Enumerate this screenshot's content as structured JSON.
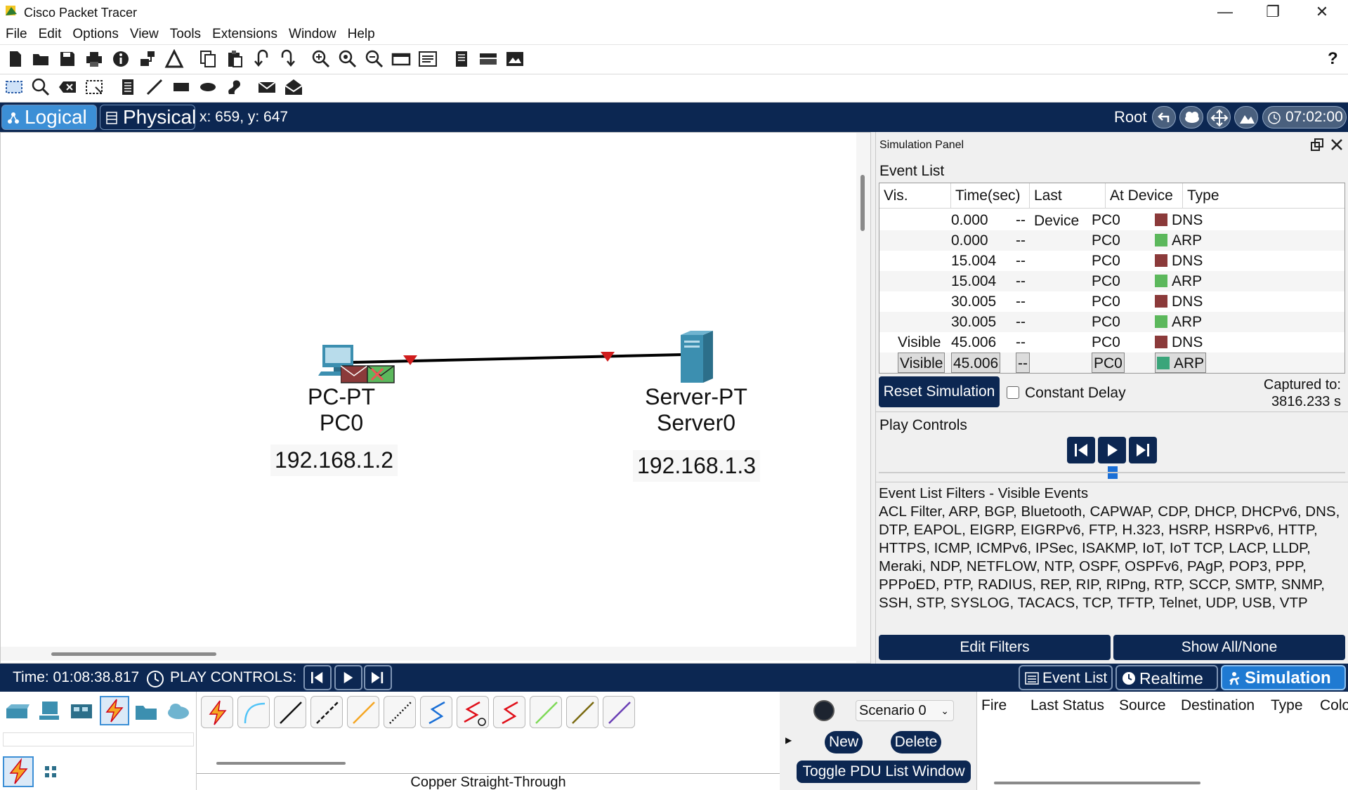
{
  "window": {
    "title": "Cisco Packet Tracer",
    "controls": [
      "minimize-icon",
      "restore-icon",
      "close-icon"
    ]
  },
  "menu": [
    "File",
    "Edit",
    "Options",
    "View",
    "Tools",
    "Extensions",
    "Window",
    "Help"
  ],
  "toolbar_main": {
    "icons": [
      "new-file-icon",
      "open-folder-icon",
      "save-icon",
      "print-icon",
      "info-icon",
      "network-wizard-icon",
      "activity-wizard-icon",
      "copy-icon",
      "paste-icon",
      "undo-icon",
      "redo-icon",
      "zoom-in-icon",
      "zoom-reset-icon",
      "zoom-out-icon",
      "drawing-palette-icon",
      "custom-device-dialog-icon",
      "document-icon",
      "device-template-icon",
      "image-view-icon"
    ],
    "help_label": "?"
  },
  "toolbar_common": {
    "icons": [
      "select-icon",
      "inspect-icon",
      "delete-icon",
      "resize-shape-icon",
      "note-icon",
      "draw-line-icon",
      "draw-rectangle-icon",
      "draw-ellipse-icon",
      "freeform-icon",
      "add-simple-pdu-icon",
      "add-complex-pdu-icon"
    ]
  },
  "modebar": {
    "logical_label": "Logical",
    "physical_label": "Physical",
    "coords": "x: 659, y: 647",
    "root_label": "Root",
    "clock": "07:02:00"
  },
  "workspace": {
    "devices": [
      {
        "type": "PC-PT",
        "name": "PC0",
        "ip": "192.168.1.2"
      },
      {
        "type": "Server-PT",
        "name": "Server0",
        "ip": "192.168.1.3"
      }
    ]
  },
  "simulation_panel": {
    "title": "Simulation Panel",
    "event_list_label": "Event List",
    "columns": [
      "Vis.",
      "Time(sec)",
      "Last Device",
      "At Device",
      "Type"
    ],
    "events": [
      {
        "vis": "",
        "time": "0.000",
        "last": "--",
        "at": "PC0",
        "type": "DNS",
        "color": "#8b3a3a",
        "selected": false
      },
      {
        "vis": "",
        "time": "0.000",
        "last": "--",
        "at": "PC0",
        "type": "ARP",
        "color": "#5cb85c",
        "selected": false
      },
      {
        "vis": "",
        "time": "15.004",
        "last": "--",
        "at": "PC0",
        "type": "DNS",
        "color": "#8b3a3a",
        "selected": false
      },
      {
        "vis": "",
        "time": "15.004",
        "last": "--",
        "at": "PC0",
        "type": "ARP",
        "color": "#5cb85c",
        "selected": false
      },
      {
        "vis": "",
        "time": "30.005",
        "last": "--",
        "at": "PC0",
        "type": "DNS",
        "color": "#8b3a3a",
        "selected": false
      },
      {
        "vis": "",
        "time": "30.005",
        "last": "--",
        "at": "PC0",
        "type": "ARP",
        "color": "#5cb85c",
        "selected": false
      },
      {
        "vis": "Visible",
        "time": "45.006",
        "last": "--",
        "at": "PC0",
        "type": "DNS",
        "color": "#8b3a3a",
        "selected": false
      },
      {
        "vis": "Visible",
        "time": "45.006",
        "last": "--",
        "at": "PC0",
        "type": "ARP",
        "color": "#3aa57a",
        "selected": true
      }
    ],
    "reset_label": "Reset Simulation",
    "constant_delay_label": "Constant Delay",
    "constant_delay_checked": false,
    "captured_label": "Captured to:",
    "captured_value": "3816.233 s",
    "play_controls_label": "Play Controls",
    "filters_label": "Event List Filters - Visible Events",
    "filters_text": "ACL Filter, ARP, BGP, Bluetooth, CAPWAP, CDP, DHCP, DHCPv6, DNS, DTP, EAPOL, EIGRP, EIGRPv6, FTP, H.323, HSRP, HSRPv6, HTTP, HTTPS, ICMP, ICMPv6, IPSec, ISAKMP, IoT, IoT TCP, LACP, LLDP, Meraki, NDP, NETFLOW, NTP, OSPF, OSPFv6, PAgP, POP3, PPP, PPPoED, PTP, RADIUS, REP, RIP, RIPng, RTP, SCCP, SMTP, SNMP, SSH, STP, SYSLOG, TACACS, TCP, TFTP, Telnet, UDP, USB, VTP",
    "edit_filters_label": "Edit Filters",
    "show_all_label": "Show All/None"
  },
  "statusbar": {
    "time": "Time: 01:08:38.817",
    "play_controls": "PLAY CONTROLS:",
    "event_list_tab": "Event List",
    "realtime_tab": "Realtime",
    "simulation_tab": "Simulation"
  },
  "bottom": {
    "connection_label": "Copper Straight-Through",
    "scenario": "Scenario 0",
    "new_label": "New",
    "delete_label": "Delete",
    "toggle_label": "Toggle PDU List Window",
    "pdu_columns": [
      "Fire",
      "Last Status",
      "Source",
      "Destination",
      "Type",
      "Colo"
    ]
  },
  "colors": {
    "navy": "#0c2752",
    "dns": "#8b3a3a",
    "arp": "#5cb85c"
  }
}
